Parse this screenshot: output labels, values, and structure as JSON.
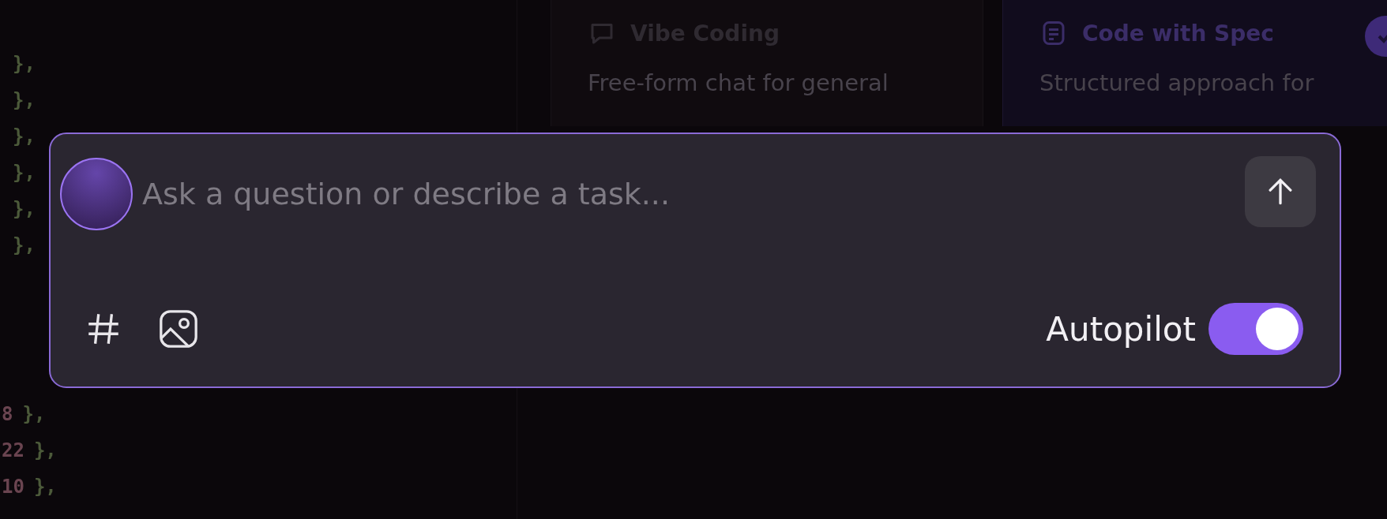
{
  "editor": {
    "lines_top": [
      {
        "text": "},"
      },
      {
        "text": "},"
      },
      {
        "text": "},"
      },
      {
        "text": "},"
      },
      {
        "text": "},"
      },
      {
        "text": "},"
      }
    ],
    "lines_bottom": [
      {
        "number": "8",
        "text": "},"
      },
      {
        "number": "22",
        "text": "},"
      },
      {
        "number": "10",
        "text": "},"
      }
    ]
  },
  "modes": [
    {
      "kind": "chat",
      "title": "Vibe Coding",
      "description": "Free-form chat for general",
      "selected": false
    },
    {
      "kind": "spec",
      "title": "Code with Spec",
      "description": "Structured approach for",
      "selected": true
    }
  ],
  "prompt": {
    "placeholder": "Ask a question or describe a task...",
    "autopilot": {
      "label": "Autopilot",
      "on": true
    }
  }
}
